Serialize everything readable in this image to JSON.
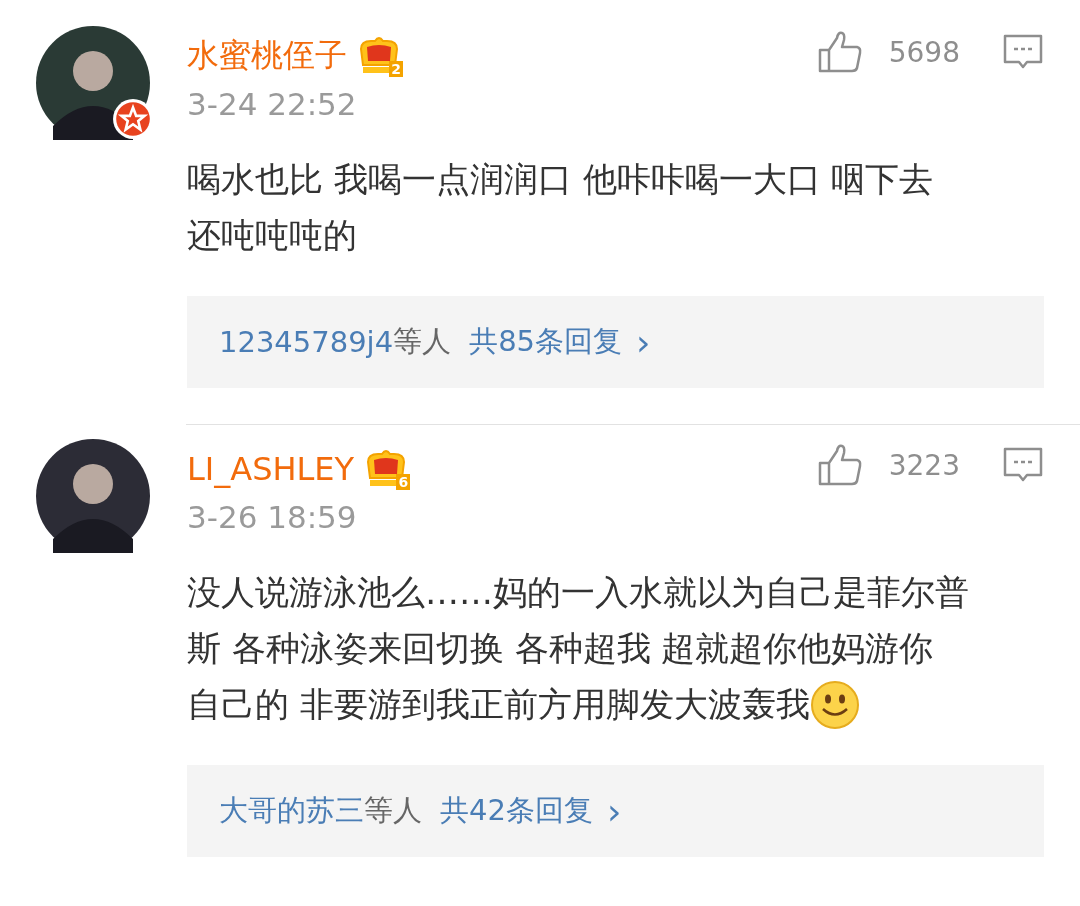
{
  "comments": [
    {
      "username": "水蜜桃侄子",
      "vip_level": "2",
      "verified": true,
      "time": "3-24 22:52",
      "likes": "5698",
      "lines": [
        "喝水也比 我喝一点润润口 他咔咔喝一大口 咽下去",
        "还吨吨吨的"
      ],
      "emoji": false,
      "replies": {
        "users": "12345789j4",
        "suffix": "等人",
        "total": "共85条回复",
        "chevron": "›"
      }
    },
    {
      "username": "LI_ASHLEY",
      "vip_level": "6",
      "verified": false,
      "time": "3-26 18:59",
      "likes": "3223",
      "lines": [
        "没人说游泳池么……妈的一入水就以为自己是菲尔普",
        "斯 各种泳姿来回切换 各种超我 超就超你他妈游你",
        "自己的 非要游到我正前方用脚发大波轰我"
      ],
      "emoji": true,
      "replies": {
        "users": "大哥的苏三",
        "suffix": "等人",
        "total": "共42条回复",
        "chevron": "›"
      }
    }
  ]
}
